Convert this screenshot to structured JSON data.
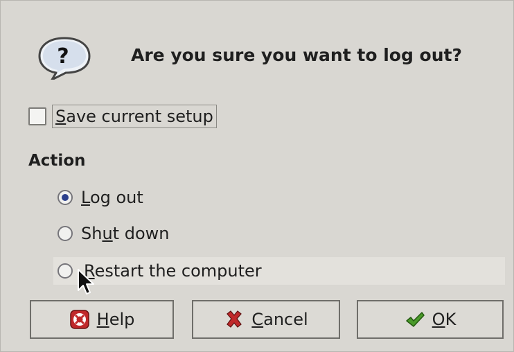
{
  "dialog": {
    "title": "Are you sure you want to log out?",
    "save_setup": {
      "mnemonic": "S",
      "rest": "ave current setup",
      "checked": false
    },
    "action_label": "Action",
    "options": [
      {
        "pre": "",
        "mnemonic": "L",
        "post": "og out",
        "selected": true
      },
      {
        "pre": "Sh",
        "mnemonic": "u",
        "post": "t down",
        "selected": false
      },
      {
        "pre": "",
        "mnemonic": "R",
        "post": "estart the computer",
        "selected": false
      }
    ],
    "buttons": {
      "help": {
        "mnemonic": "H",
        "rest": "elp"
      },
      "cancel": {
        "mnemonic": "C",
        "rest": "ancel"
      },
      "ok": {
        "mnemonic": "O",
        "rest": "K"
      }
    },
    "icons": {
      "question": "question-icon",
      "help": "lifebuoy-icon",
      "cancel": "x-icon",
      "ok": "checkmark-icon"
    },
    "colors": {
      "radio_dot": "#2b3f8c",
      "help_icon": "#c0282a",
      "cancel_icon": "#c0282a",
      "ok_icon": "#4a9a2a"
    }
  }
}
